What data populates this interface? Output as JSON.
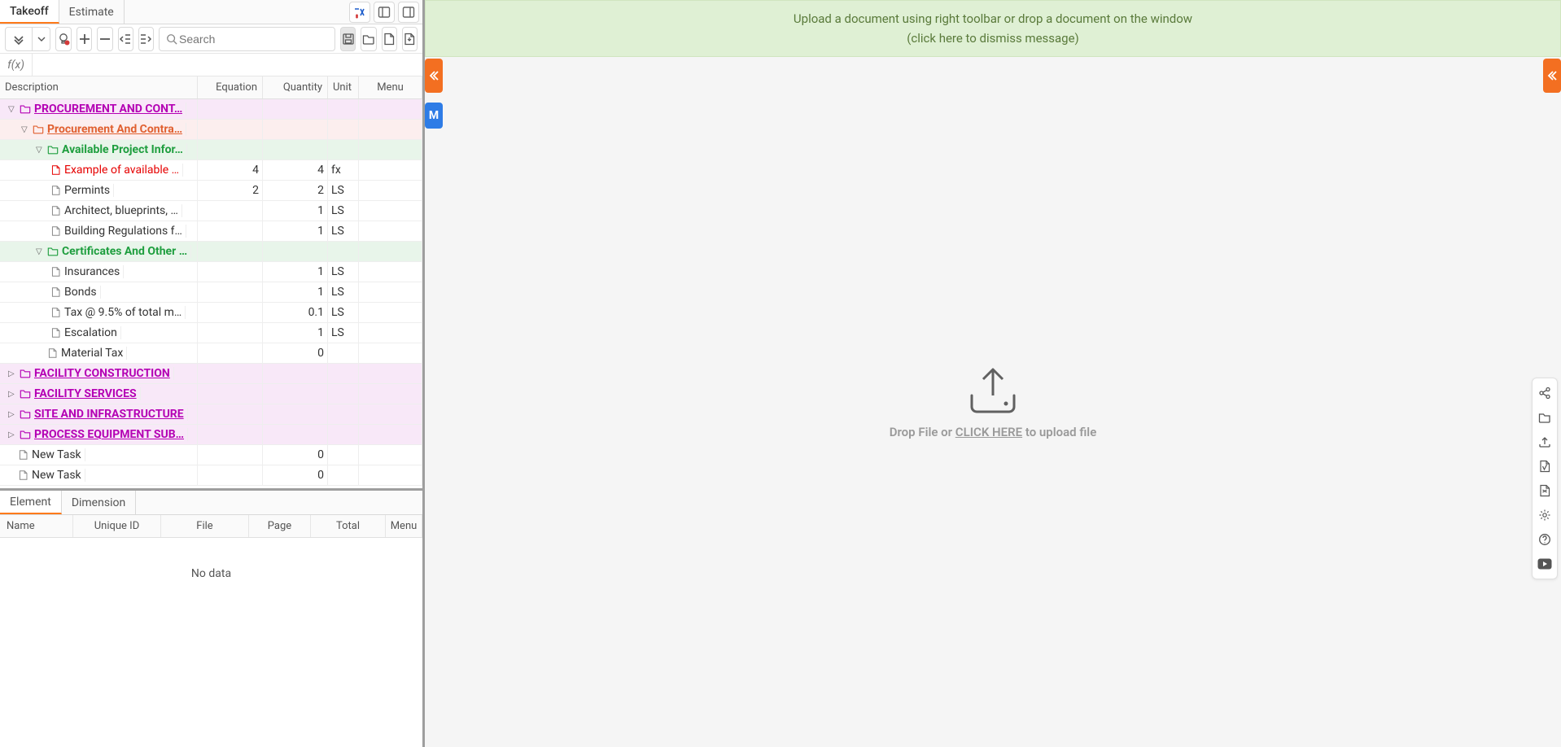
{
  "top_tabs": {
    "takeoff": "Takeoff",
    "estimate": "Estimate"
  },
  "toolbar": {
    "search_placeholder": "Search"
  },
  "fx_label": "f(x)",
  "grid_headers": {
    "description": "Description",
    "equation": "Equation",
    "quantity": "Quantity",
    "unit": "Unit",
    "menu": "Menu"
  },
  "rows": [
    {
      "type": "l1",
      "expanded": true,
      "label": "PROCUREMENT AND CONT…"
    },
    {
      "type": "l2",
      "expanded": true,
      "label": "Procurement And Contra…"
    },
    {
      "type": "l3",
      "expanded": true,
      "label": "Available Project Infor…"
    },
    {
      "type": "item",
      "style": "red",
      "label": "Example of available …",
      "equation": "4",
      "quantity": "4",
      "unit": "fx"
    },
    {
      "type": "item",
      "label": "Permints",
      "equation": "2",
      "quantity": "2",
      "unit": "LS"
    },
    {
      "type": "item",
      "label": "Architect, blueprints, …",
      "equation": "",
      "quantity": "1",
      "unit": "LS"
    },
    {
      "type": "item",
      "label": "Building Regulations f…",
      "equation": "",
      "quantity": "1",
      "unit": "LS"
    },
    {
      "type": "l3",
      "expanded": true,
      "label": "Certificates And Other …"
    },
    {
      "type": "item",
      "label": "Insurances",
      "equation": "",
      "quantity": "1",
      "unit": "LS"
    },
    {
      "type": "item",
      "label": "Bonds",
      "equation": "",
      "quantity": "1",
      "unit": "LS"
    },
    {
      "type": "item",
      "label": "Tax @ 9.5% of total m…",
      "equation": "",
      "quantity": "0.1",
      "unit": "LS"
    },
    {
      "type": "item",
      "label": "Escalation",
      "equation": "",
      "quantity": "1",
      "unit": "LS"
    },
    {
      "type": "item3",
      "label": "Material Tax",
      "equation": "",
      "quantity": "0",
      "unit": ""
    },
    {
      "type": "l1",
      "expanded": false,
      "label": "FACILITY CONSTRUCTION"
    },
    {
      "type": "l1",
      "expanded": false,
      "label": "FACILITY SERVICES"
    },
    {
      "type": "l1",
      "expanded": false,
      "label": "SITE AND INFRASTRUCTURE"
    },
    {
      "type": "l1",
      "expanded": false,
      "label": "PROCESS EQUIPMENT SUB…"
    },
    {
      "type": "task",
      "label": "New Task",
      "equation": "",
      "quantity": "0",
      "unit": ""
    },
    {
      "type": "task",
      "label": "New Task",
      "equation": "",
      "quantity": "0",
      "unit": ""
    }
  ],
  "bottom_tabs": {
    "element": "Element",
    "dimension": "Dimension"
  },
  "bottom_headers": {
    "name": "Name",
    "uid": "Unique ID",
    "file": "File",
    "page": "Page",
    "total": "Total",
    "menu": "Menu"
  },
  "bottom_nodata": "No data",
  "banner": {
    "line1": "Upload a document using right toolbar or drop a document on the window",
    "line2": "(click here to dismiss message)"
  },
  "dropzone": {
    "prefix": "Drop File or ",
    "link": "CLICK HERE",
    "suffix": " to upload file"
  },
  "side_m": "M"
}
